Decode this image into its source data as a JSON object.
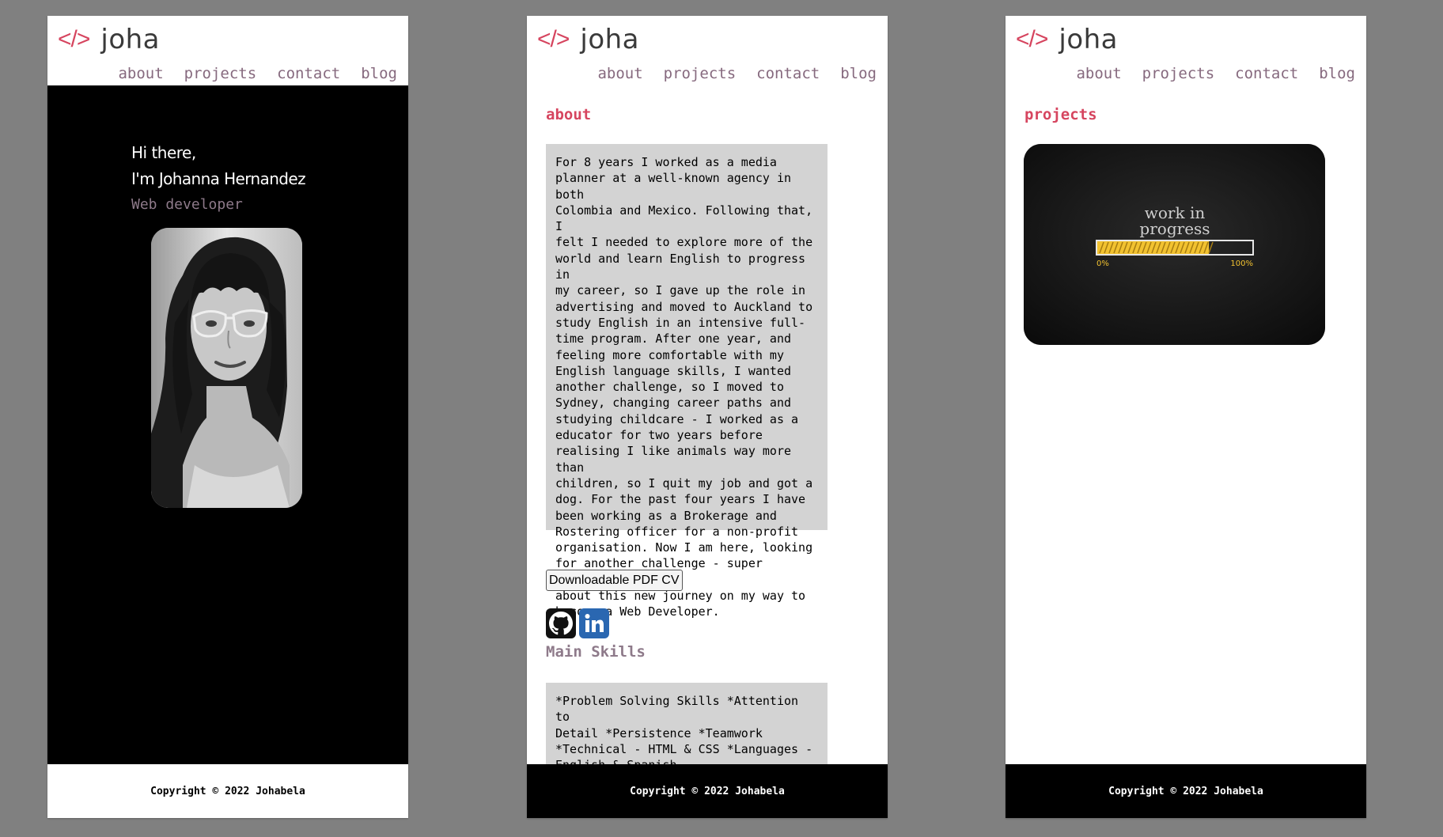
{
  "header": {
    "logo_code": "</>",
    "logo_name": "joha",
    "nav": [
      "about",
      "projects",
      "contact",
      "blog"
    ]
  },
  "home": {
    "greeting_line1": "Hi there,",
    "greeting_line2": "I'm Johanna Hernandez",
    "role": "Web developer",
    "photo_icon": "profile-photo"
  },
  "about": {
    "title": "about",
    "text": "For 8 years I worked as a media\nplanner at a well-known agency in both\nColombia and Mexico. Following that, I\nfelt I needed to explore more of the\nworld and learn English to progress in\nmy career, so I gave up the role in\nadvertising and moved to Auckland to\nstudy English in an intensive full-\ntime program. After one year, and\nfeeling more comfortable with my\nEnglish language skills, I wanted\nanother challenge, so I moved to\nSydney, changing career paths and\nstudying childcare - I worked as a\neducator for two years before\nrealising I like animals way more than\nchildren, so I quit my job and got a\ndog. For the past four years I have\nbeen working as a Brokerage and\nRostering officer for a non-profit\norganisation. Now I am here, looking\nfor another challenge - super excited\nabout this new journey on my way to\nbecome a Web Developer.",
    "cv_button": "Downloadable PDF CV",
    "social_icons": [
      "github-icon",
      "linkedin-icon"
    ],
    "skills_title": "Main Skills",
    "skills_text": "*Problem Solving Skills *Attention to\nDetail *Persistence *Teamwork\n*Technical - HTML & CSS *Languages -\nEnglish & Spanish"
  },
  "projects": {
    "title": "projects",
    "card": {
      "line1": "work in",
      "line2": "progress",
      "start_label": "0%",
      "end_label": "100%",
      "progress": 0.72
    }
  },
  "footer": {
    "copyright": "Copyright © 2022 Johabela"
  },
  "colors": {
    "accent": "#d6455f",
    "muted": "#86697e",
    "box": "#d3d3d3",
    "progress_fill": "#f2c230"
  }
}
